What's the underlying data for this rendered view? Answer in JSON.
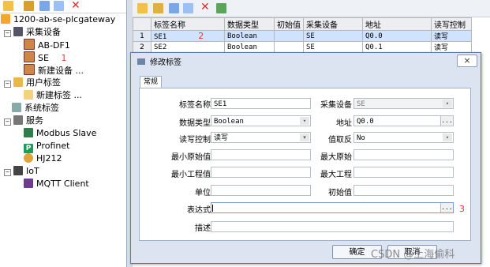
{
  "tree": {
    "root": "1200-ab-se-plcgateway",
    "items": [
      {
        "label": "采集设备"
      },
      {
        "label": "AB-DF1"
      },
      {
        "label": "SE",
        "badge": "1"
      },
      {
        "label": "新建设备 ..."
      },
      {
        "label": "用户标签"
      },
      {
        "label": "新建标签 ..."
      },
      {
        "label": "系统标签"
      },
      {
        "label": "服务"
      },
      {
        "label": "Modbus Slave"
      },
      {
        "label": "Profinet"
      },
      {
        "label": "HJ212"
      },
      {
        "label": "IoT"
      },
      {
        "label": "MQTT Client"
      }
    ]
  },
  "grid": {
    "headers": [
      "标签名称",
      "数据类型",
      "初始值",
      "采集设备",
      "地址",
      "读写控制"
    ],
    "rows": [
      {
        "num": "1",
        "name": "SE1",
        "badge": "2",
        "type": "Boolean",
        "init": "",
        "device": "SE",
        "addr": "Q0.0",
        "rw": "读写"
      },
      {
        "num": "2",
        "name": "SE2",
        "type": "Boolean",
        "init": "",
        "device": "SE",
        "addr": "Q0.1",
        "rw": "读写"
      }
    ]
  },
  "dialog": {
    "title": "修改标签",
    "close": "×",
    "tab": "常规",
    "labels": {
      "name": "标签名称",
      "type": "数据类型",
      "rw": "读写控制",
      "rawmin": "最小原始值",
      "engmin": "最小工程值",
      "unit": "单位",
      "expr": "表达式",
      "desc": "描述",
      "device": "采集设备",
      "addr": "地址",
      "invert": "值取反",
      "rawmax": "最大原始",
      "engmax": "最大工程",
      "init": "初始值"
    },
    "values": {
      "name": "SE1",
      "type": "Boolean",
      "rw": "读写",
      "device": "SE",
      "addr": "Q0.0",
      "invert": "No",
      "expr": "",
      "expr_badge": "3"
    },
    "ok": "确定",
    "cancel": "取消"
  },
  "watermark": "CSDN @上海偷科",
  "colors": {
    "accent": "#e53935",
    "dialog": "#dce4f1",
    "selected_row": "#cfe3ff"
  }
}
